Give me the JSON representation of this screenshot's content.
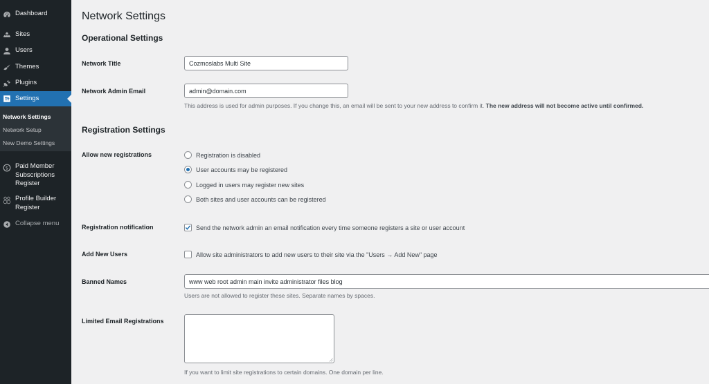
{
  "sidebar": {
    "items": [
      {
        "label": "Dashboard",
        "icon": "dashboard-icon"
      },
      {
        "label": "Sites",
        "icon": "sites-icon"
      },
      {
        "label": "Users",
        "icon": "users-icon"
      },
      {
        "label": "Themes",
        "icon": "themes-icon"
      },
      {
        "label": "Plugins",
        "icon": "plugins-icon"
      },
      {
        "label": "Settings",
        "icon": "settings-icon",
        "active": true
      }
    ],
    "submenu": [
      {
        "label": "Network Settings",
        "current": true
      },
      {
        "label": "Network Setup"
      },
      {
        "label": "New Demo Settings"
      }
    ],
    "extra_items": [
      {
        "label": "Paid Member Subscriptions Register",
        "lines": [
          "Paid Member",
          "Subscriptions",
          "Register"
        ],
        "icon": "paid-member-icon"
      },
      {
        "label": "Profile Builder Register",
        "lines": [
          "Profile Builder",
          "Register"
        ],
        "icon": "profile-builder-icon"
      }
    ],
    "collapse_label": "Collapse menu"
  },
  "page": {
    "title": "Network Settings",
    "sections": {
      "operational": "Operational Settings",
      "registration": "Registration Settings"
    },
    "network_title": {
      "label": "Network Title",
      "value": "Cozmoslabs Multi Site"
    },
    "admin_email": {
      "label": "Network Admin Email",
      "value": "admin@domain.com",
      "description": "This address is used for admin purposes. If you change this, an email will be sent to your new address to confirm it.",
      "description_bold": "The new address will not become active until confirmed."
    },
    "allow_registrations": {
      "label": "Allow new registrations",
      "options": [
        {
          "label": "Registration is disabled",
          "checked": false
        },
        {
          "label": "User accounts may be registered",
          "checked": true
        },
        {
          "label": "Logged in users may register new sites",
          "checked": false
        },
        {
          "label": "Both sites and user accounts can be registered",
          "checked": false
        }
      ]
    },
    "registration_notification": {
      "label": "Registration notification",
      "option": "Send the network admin an email notification every time someone registers a site or user account",
      "checked": true
    },
    "add_new_users": {
      "label": "Add New Users",
      "option": "Allow site administrators to add new users to their site via the \"Users → Add New\" page",
      "checked": false
    },
    "banned_names": {
      "label": "Banned Names",
      "value": "www web root admin main invite administrator files blog",
      "description": "Users are not allowed to register these sites. Separate names by spaces."
    },
    "limited_email": {
      "label": "Limited Email Registrations",
      "value": "",
      "description": "If you want to limit site registrations to certain domains. One domain per line."
    }
  },
  "colors": {
    "sidebar_bg": "#1d2327",
    "submenu_bg": "#2c3338",
    "accent": "#2271b1",
    "page_bg": "#f0f0f1"
  }
}
